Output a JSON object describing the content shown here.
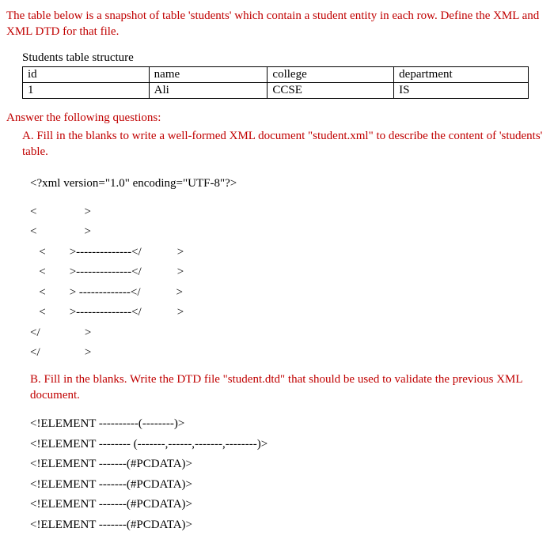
{
  "intro": "The table below is a snapshot of table 'students' which contain a student entity in each row. Define the XML and XML DTD for that file.",
  "tableTitle": "Students table structure",
  "table": {
    "headers": [
      "id",
      "name",
      "college",
      "department"
    ],
    "row": [
      "1",
      "Ali",
      "CCSE",
      "IS"
    ]
  },
  "answerHeading": "Answer the following questions:",
  "qA_indent": "A. Fill in the blanks to write a well-formed XML document \"student.xml\" to describe the content of 'students' table.",
  "xmlDecl": "<?xml version=\"1.0\" encoding=\"UTF-8\"?>",
  "xmlLines": [
    "<                >",
    "<                >",
    "   <        >--------------</            >",
    "   <        >--------------</            >",
    "   <        > -------------</            >",
    "   <        >--------------</            >",
    "</               >",
    "</               >"
  ],
  "qB": "B. Fill in the blanks.  Write the DTD file \"student.dtd\" that should be used to validate the previous XML document.",
  "dtdLines": [
    "<!ELEMENT ----------(--------)>",
    "",
    "<!ELEMENT -------- (-------,------,-------,--------)>",
    "<!ELEMENT -------(#PCDATA)>",
    "<!ELEMENT -------(#PCDATA)>",
    "<!ELEMENT -------(#PCDATA)>",
    "<!ELEMENT -------(#PCDATA)>"
  ]
}
